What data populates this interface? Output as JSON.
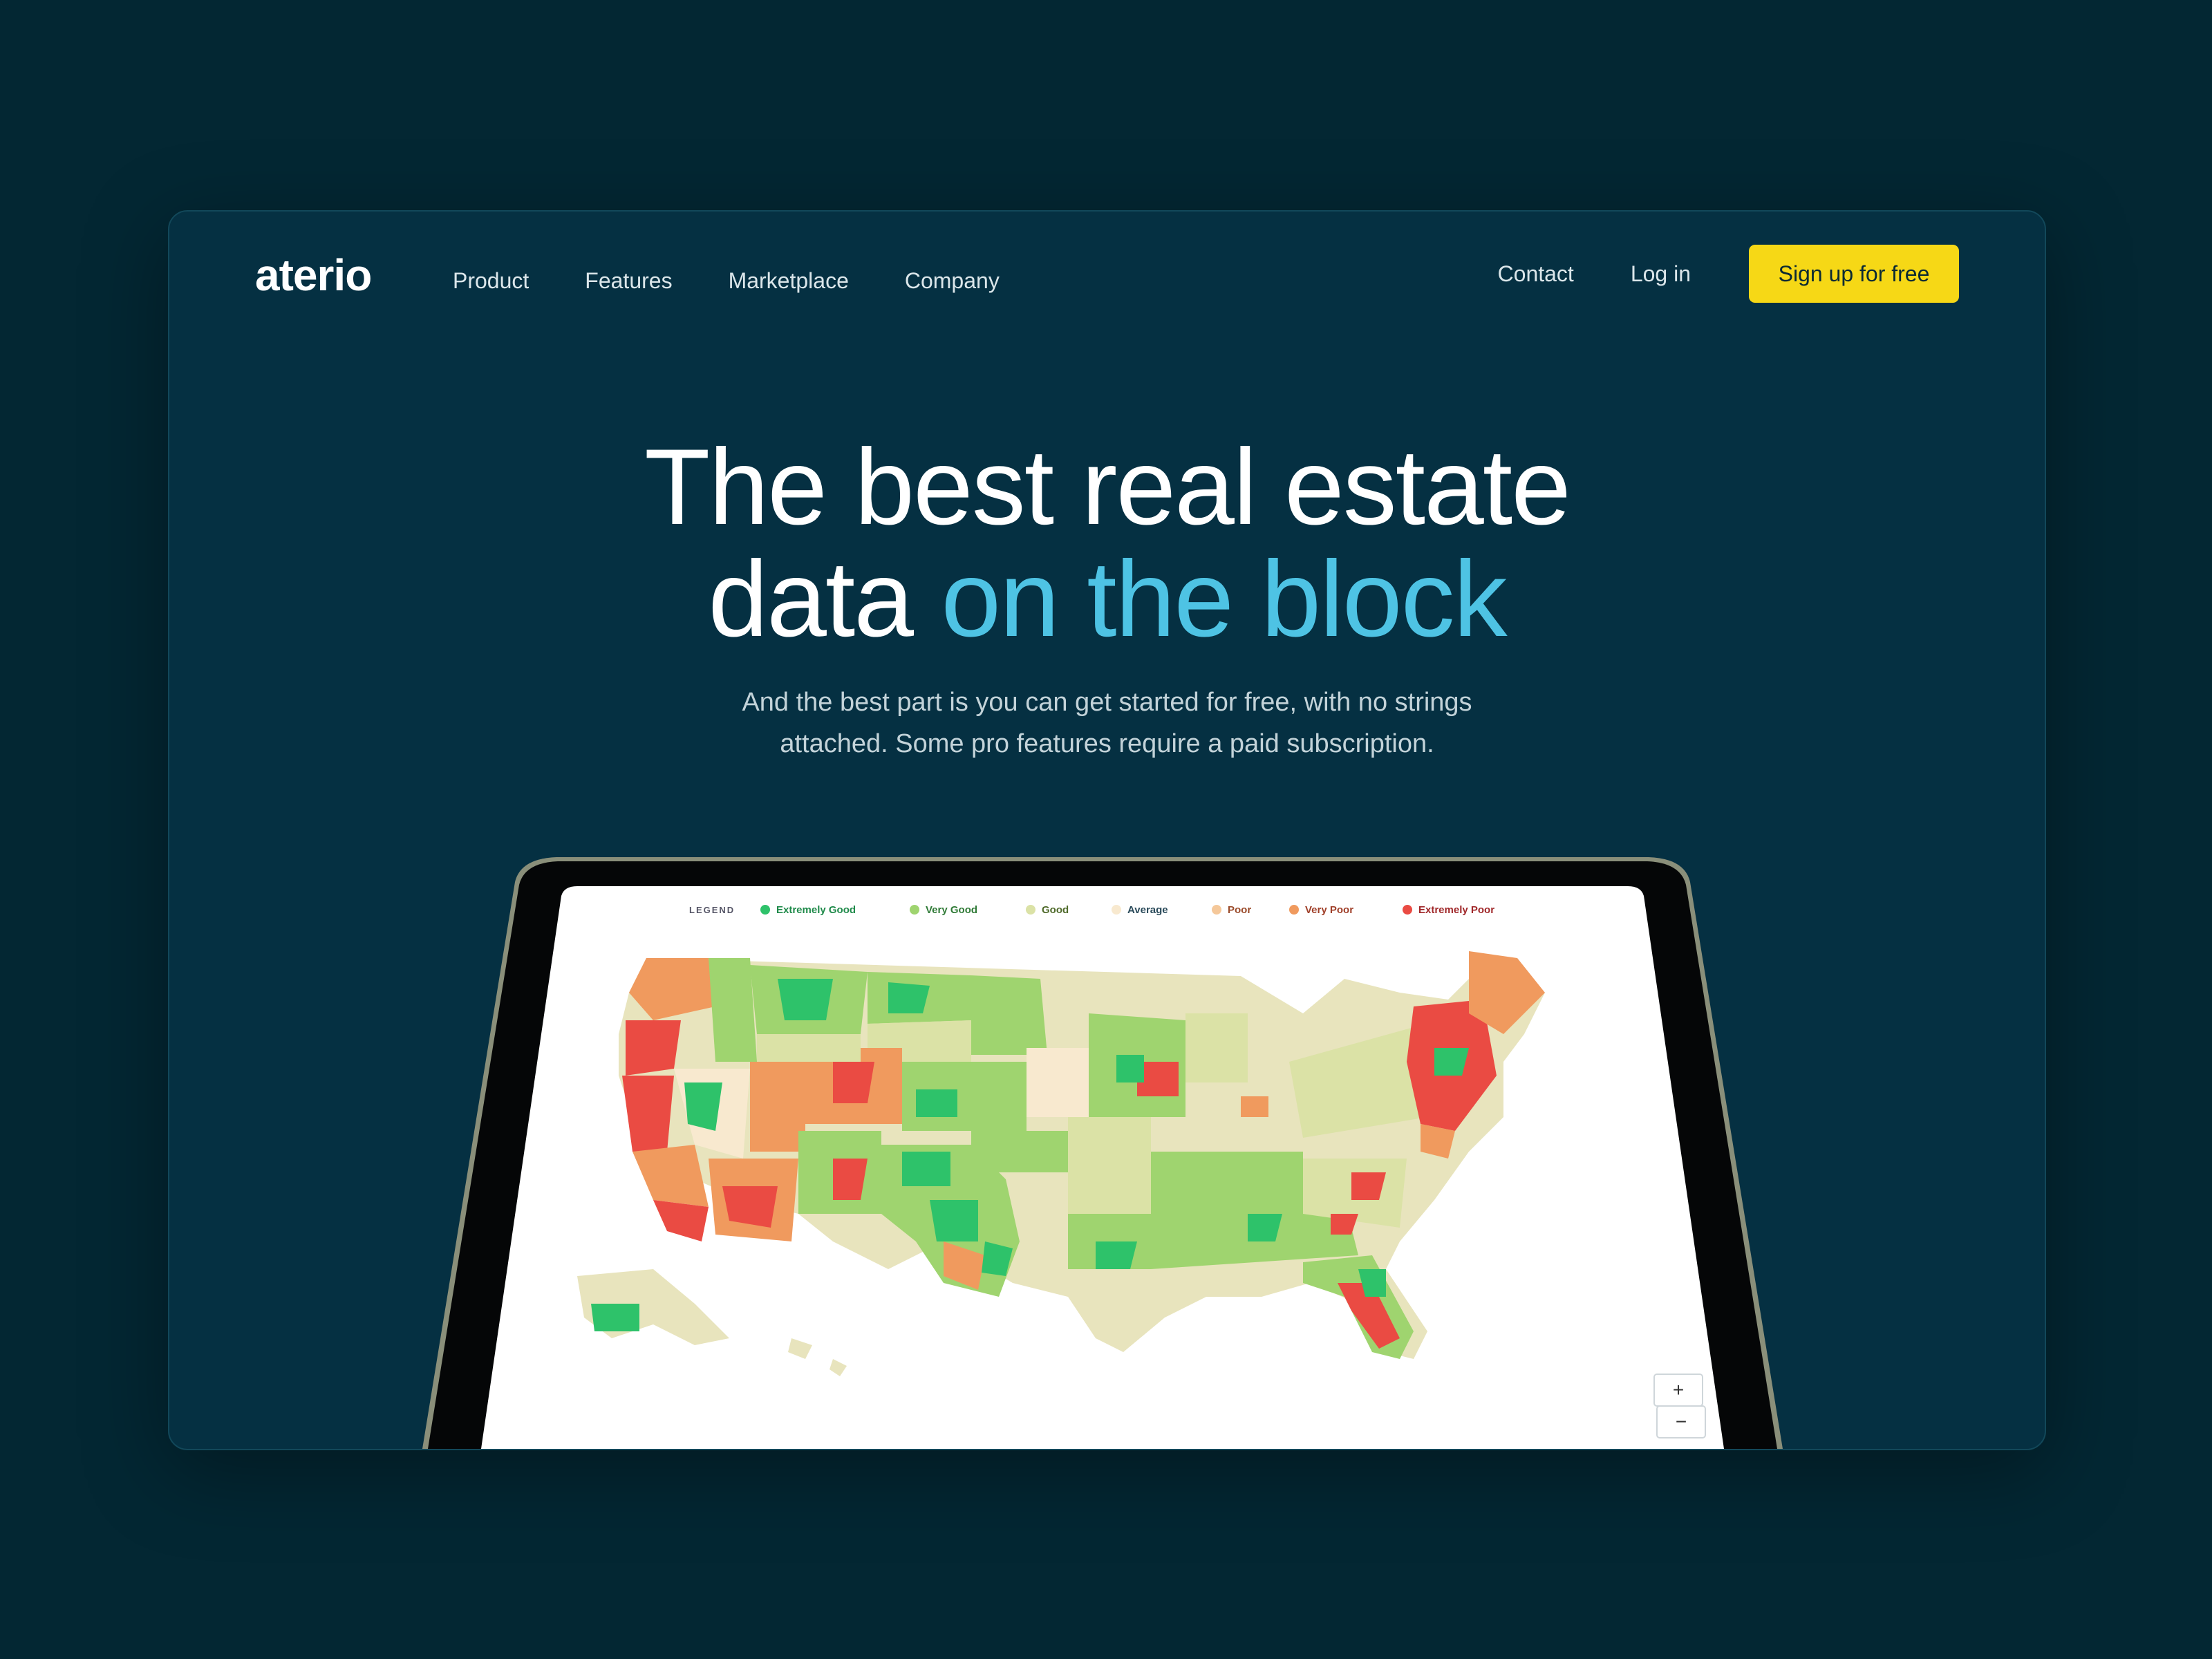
{
  "brand": {
    "logo": "aterio"
  },
  "nav": {
    "links": [
      "Product",
      "Features",
      "Marketplace",
      "Company"
    ],
    "contact": "Contact",
    "login": "Log in",
    "signup": "Sign up for free"
  },
  "hero": {
    "title_line1": "The best real estate",
    "title_line2_plain": "data ",
    "title_line2_accent": "on the block",
    "subtitle_line1": "And the best part is you can get started for free, with no strings",
    "subtitle_line2": "attached. Some pro features require a paid subscription."
  },
  "map": {
    "legend_title": "LEGEND",
    "legend": [
      {
        "label": "Extremely Good",
        "color": "#2ec26a"
      },
      {
        "label": "Very Good",
        "color": "#9fd46f"
      },
      {
        "label": "Good",
        "color": "#dbe2a6"
      },
      {
        "label": "Average",
        "color": "#f8e9cf"
      },
      {
        "label": "Poor",
        "color": "#f5c89a"
      },
      {
        "label": "Very Poor",
        "color": "#f09a5e"
      },
      {
        "label": "Extremely Poor",
        "color": "#ea4b43"
      }
    ],
    "zoom_in": "+",
    "zoom_out": "−"
  },
  "colors": {
    "background": "#032733",
    "card": "#053042",
    "accent": "#4ec3e4",
    "cta": "#f6d816"
  }
}
